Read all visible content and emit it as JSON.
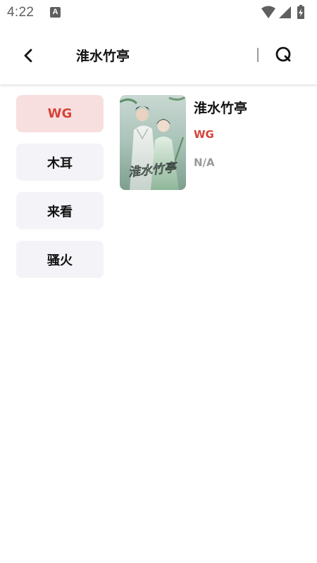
{
  "status_bar": {
    "time": "4:22",
    "notification_badge": "A",
    "icons": [
      "wifi-icon",
      "cellular-signal-icon",
      "battery-charging-icon"
    ]
  },
  "app_bar": {
    "title": "淮水竹亭",
    "back_icon": "chevron-left-icon",
    "search_icon": "search-icon"
  },
  "sources": [
    {
      "label": "WG",
      "selected": true
    },
    {
      "label": "木耳",
      "selected": false
    },
    {
      "label": "来看",
      "selected": false
    },
    {
      "label": "骚火",
      "selected": false
    }
  ],
  "results": [
    {
      "title": "淮水竹亭",
      "source": "WG",
      "status": "N/A",
      "poster_text": "淮水竹亭"
    }
  ],
  "colors": {
    "accent": "#d5443a",
    "selected_bg": "#f8dfdf",
    "chip_bg": "#f4f4f8",
    "muted_text": "#9a9a9a",
    "status_icons": "#5f5f5f"
  }
}
